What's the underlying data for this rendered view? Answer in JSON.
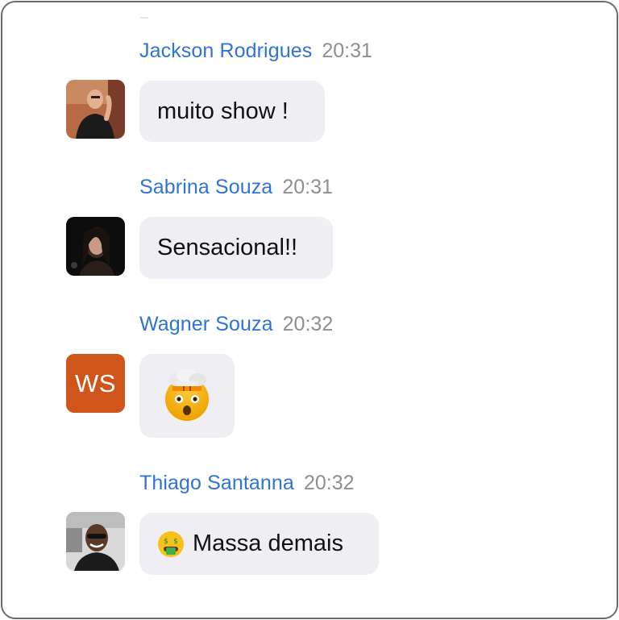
{
  "messages": [
    {
      "sender": "Jackson Rodrigues",
      "time": "20:31",
      "text": "muito show !",
      "avatar": "photo"
    },
    {
      "sender": "Sabrina Souza",
      "time": "20:31",
      "text": "Sensacional!!",
      "avatar": "photo"
    },
    {
      "sender": "Wagner Souza",
      "time": "20:32",
      "avatar_initials": "WS",
      "avatar_color": "#d0551a",
      "emoji_icon": "exploding-head-emoji"
    },
    {
      "sender": "Thiago Santanna",
      "time": "20:32",
      "text": "Massa demais",
      "emoji_icon": "money-mouth-face-emoji",
      "avatar": "photo"
    }
  ],
  "colors": {
    "sender_name": "#2f73d6",
    "timestamp": "#8e8e93",
    "bubble_bg": "#efeff3"
  }
}
